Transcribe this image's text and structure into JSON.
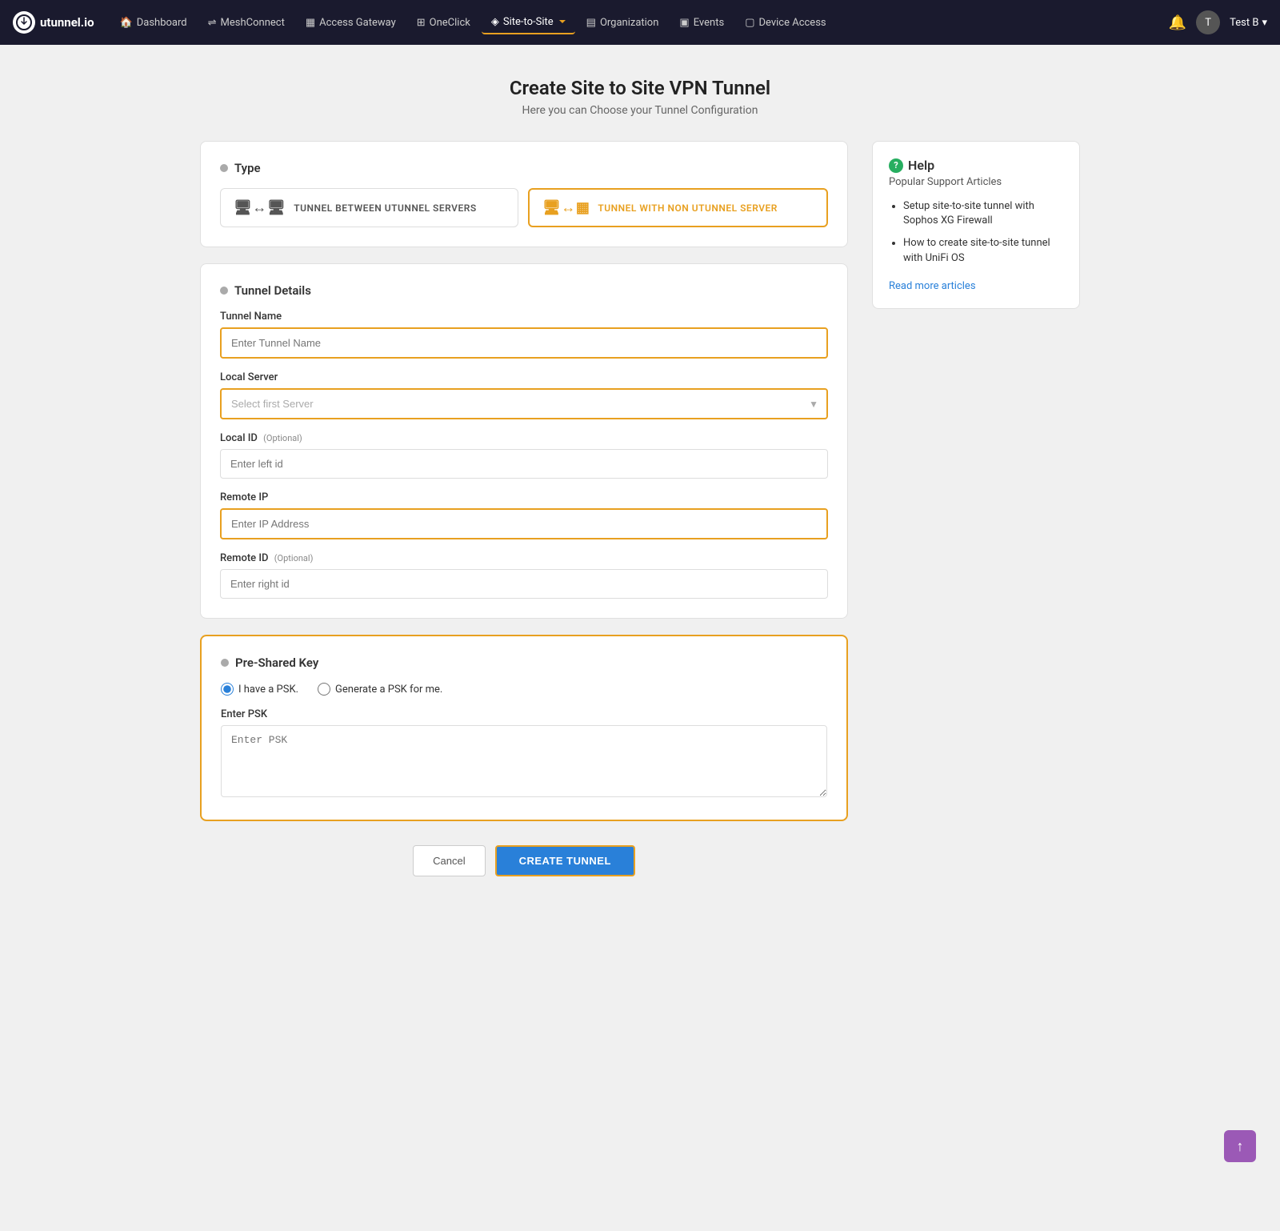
{
  "app": {
    "logo_text": "utunnel.io",
    "logo_icon": "U"
  },
  "nav": {
    "items": [
      {
        "label": "Dashboard",
        "icon": "🏠",
        "active": false
      },
      {
        "label": "MeshConnect",
        "icon": "⇌",
        "active": false
      },
      {
        "label": "Access Gateway",
        "icon": "▦",
        "active": false
      },
      {
        "label": "OneClick",
        "icon": "⊞",
        "active": false
      },
      {
        "label": "Site-to-Site",
        "icon": "◈",
        "active": true
      },
      {
        "label": "Organization",
        "icon": "▤",
        "active": false
      },
      {
        "label": "Events",
        "icon": "▣",
        "active": false
      },
      {
        "label": "Device Access",
        "icon": "▢",
        "active": false
      }
    ],
    "user": "Test B",
    "user_icon": "T"
  },
  "page": {
    "title": "Create Site to Site VPN Tunnel",
    "subtitle": "Here you can Choose your Tunnel Configuration"
  },
  "type_section": {
    "title": "Type",
    "option1_label": "TUNNEL BETWEEN UTUNNEL SERVERS",
    "option2_label": "TUNNEL WITH NON UTUNNEL SERVER",
    "selected": "option2"
  },
  "tunnel_details": {
    "title": "Tunnel Details",
    "tunnel_name_label": "Tunnel Name",
    "tunnel_name_placeholder": "Enter Tunnel Name",
    "local_server_label": "Local Server",
    "local_server_placeholder": "Select first Server",
    "local_id_label": "Local ID",
    "local_id_optional": "(Optional)",
    "local_id_placeholder": "Enter left id",
    "remote_ip_label": "Remote IP",
    "remote_ip_placeholder": "Enter IP Address",
    "remote_id_label": "Remote ID",
    "remote_id_optional": "(Optional)",
    "remote_id_placeholder": "Enter right id"
  },
  "psk_section": {
    "title": "Pre-Shared Key",
    "radio1_label": "I have a PSK.",
    "radio2_label": "Generate a PSK for me.",
    "psk_label": "Enter PSK",
    "psk_placeholder": "Enter PSK",
    "radio1_selected": true
  },
  "actions": {
    "cancel_label": "Cancel",
    "create_label": "CREATE TUNNEL"
  },
  "help": {
    "title": "Help",
    "subtitle": "Popular Support Articles",
    "articles": [
      "Setup site-to-site tunnel with Sophos XG Firewall",
      "How to create site-to-site tunnel with UniFi OS"
    ],
    "read_more": "Read more articles"
  }
}
